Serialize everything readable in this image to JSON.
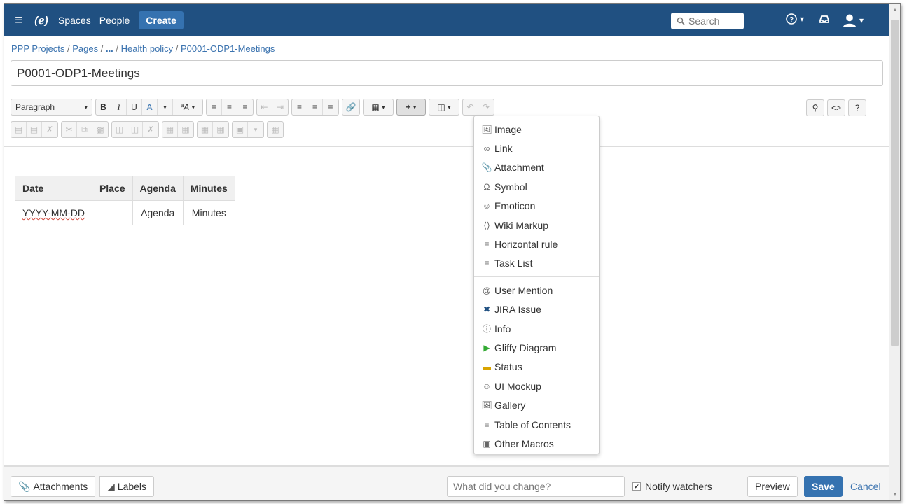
{
  "nav": {
    "spaces": "Spaces",
    "people": "People",
    "create": "Create",
    "search_placeholder": "Search"
  },
  "breadcrumb": {
    "items": [
      "PPP Projects",
      "Pages",
      "...",
      "Health policy",
      "P0001-ODP1-Meetings"
    ]
  },
  "page_title": "P0001-ODP1-Meetings",
  "toolbar": {
    "paragraph": "Paragraph"
  },
  "table": {
    "headers": [
      "Date",
      "Place",
      "Agenda",
      "Minutes"
    ],
    "rows": [
      [
        "YYYY-MM-DD",
        "",
        "Agenda",
        "Minutes"
      ]
    ]
  },
  "insert_menu": {
    "items": [
      {
        "label": "Image",
        "icon": "image-icon"
      },
      {
        "label": "Link",
        "icon": "link-icon"
      },
      {
        "label": "Attachment",
        "icon": "paperclip-icon"
      },
      {
        "label": "Symbol",
        "icon": "omega-icon"
      },
      {
        "label": "Emoticon",
        "icon": "smiley-icon"
      },
      {
        "label": "Wiki Markup",
        "icon": "markup-icon"
      },
      {
        "label": "Horizontal rule",
        "icon": "hr-icon"
      },
      {
        "label": "Task List",
        "icon": "tasklist-icon"
      }
    ],
    "macros": [
      {
        "label": "User Mention",
        "icon": "at-icon"
      },
      {
        "label": "JIRA Issue",
        "icon": "jira-icon"
      },
      {
        "label": "Info",
        "icon": "info-icon"
      },
      {
        "label": "Gliffy Diagram",
        "icon": "gliffy-icon"
      },
      {
        "label": "Status",
        "icon": "status-icon"
      },
      {
        "label": "UI Mockup",
        "icon": "mockup-icon"
      },
      {
        "label": "Gallery",
        "icon": "gallery-icon"
      },
      {
        "label": "Table of Contents",
        "icon": "toc-icon"
      },
      {
        "label": "Other Macros",
        "icon": "macros-icon"
      }
    ]
  },
  "footer": {
    "attachments": "Attachments",
    "labels": "Labels",
    "comment_placeholder": "What did you change?",
    "notify": "Notify watchers",
    "preview": "Preview",
    "save": "Save",
    "cancel": "Cancel"
  },
  "colors": {
    "nav_bg": "#205081",
    "accent": "#3572b0",
    "link": "#3b73af"
  }
}
